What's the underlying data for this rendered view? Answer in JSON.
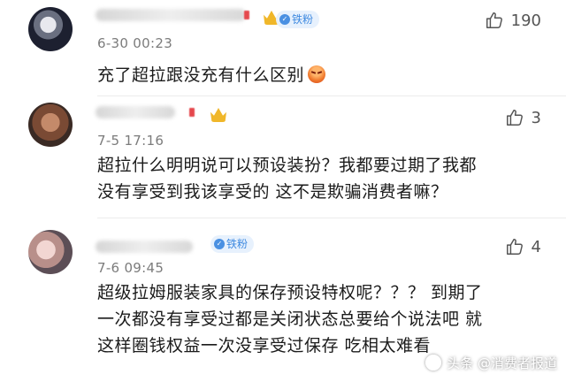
{
  "colors": {
    "badge_bg": "#e7f1fd",
    "badge_text": "#3f8ae0",
    "crown": "#f0b72a",
    "timestamp": "#7c7c7c",
    "name_dot": "#e5484d"
  },
  "comments": [
    {
      "avatar": "avatar-image",
      "username": "",
      "badge": "铁粉",
      "has_crown": true,
      "time": "6-30 00:23",
      "likes": "190",
      "text_lines": [
        "充了超拉跟没充有什么区别"
      ],
      "emoji": "angry-face-emoji"
    },
    {
      "avatar": "avatar-image",
      "username": "",
      "has_crown": true,
      "time": "7-5 17:16",
      "likes": "3",
      "text_lines": [
        "超拉什么明明说可以预设装扮？我都要过期了我都",
        "没有享受到我该享受的 这不是欺骗消费者嘛？"
      ]
    },
    {
      "avatar": "avatar-image",
      "username": "",
      "badge": "铁粉",
      "time": "7-6 09:45",
      "likes": "4",
      "text_lines": [
        "超级拉姆服装家具的保存预设特权呢？？？ 到期了",
        "一次都没有享受过都是关闭状态总要给个说法吧 就",
        "这样圈钱权益一次没享受过保存 吃相太难看"
      ]
    }
  ],
  "watermark": {
    "text": "头条 @消费者报道",
    "icon": "toutiao-logo-icon"
  }
}
